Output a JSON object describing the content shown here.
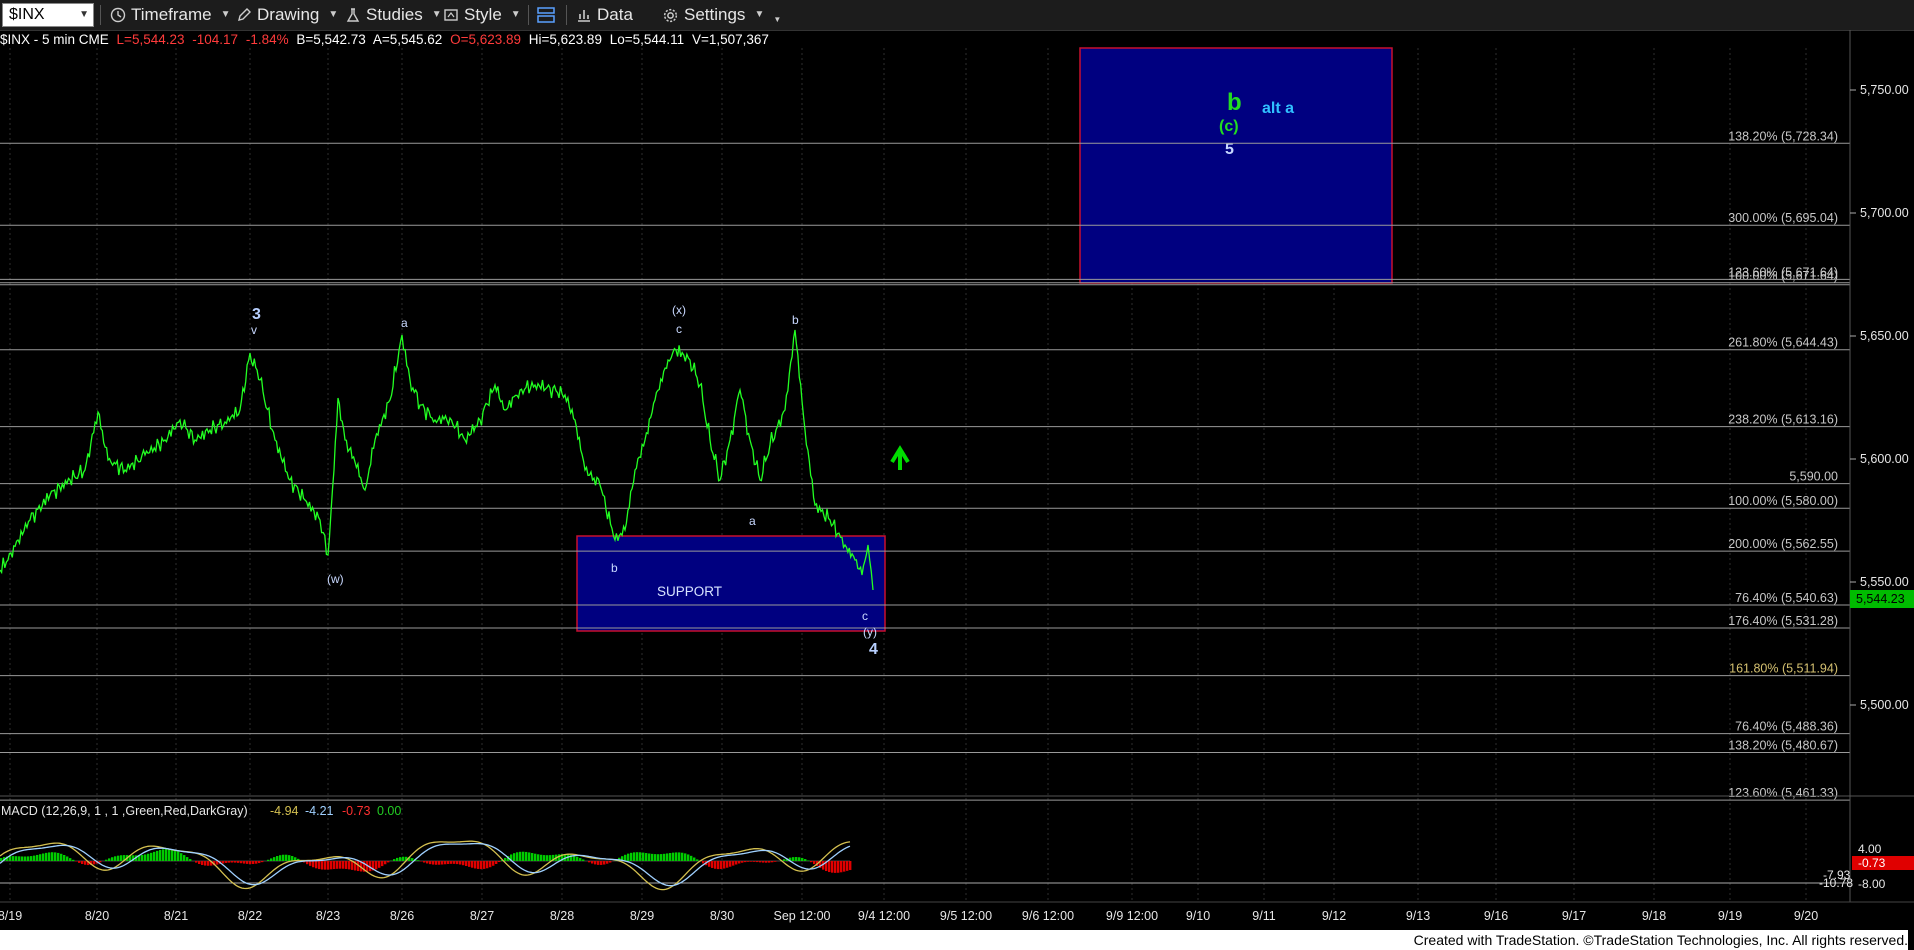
{
  "toolbar": {
    "symbol": "$INX",
    "timeframe": "Timeframe",
    "drawing": "Drawing",
    "studies": "Studies",
    "style": "Style",
    "data": "Data",
    "settings": "Settings"
  },
  "info": {
    "name": "$INX - 5 min  CME",
    "last": "L=5,544.23",
    "change": "-104.17",
    "pct": "-1.84%",
    "bid": "B=5,542.73",
    "ask": "A=5,545.62",
    "open": "O=5,623.89",
    "high": "Hi=5,623.89",
    "low": "Lo=5,544.11",
    "volume": "V=1,507,367"
  },
  "macd": {
    "label": "MACD (12,26,9, 1 , 1 ,Green,Red,DarkGray)",
    "v1": "-4.94",
    "v2": "-4.21",
    "v3": "-0.73",
    "v4": "0.00",
    "axis_top": "4.00",
    "axis_bottom": "-8.00",
    "tag_red": "-0.73",
    "tag1": "-7.93",
    "tag2": "-10.78"
  },
  "colors": {
    "price": "#22ff22",
    "box_fill": "#000080",
    "box_border": "#c8102e",
    "gridline": "#c8c8c8",
    "fib_text": "#c8c8c8",
    "up": "#00ff00",
    "down": "#e00000",
    "label": "#a8d0ff"
  },
  "axis": {
    "price_ticks": [
      "5,750.00",
      "5,700.00",
      "5,650.00",
      "5,600.00",
      "5,550.00",
      "5,500.00"
    ],
    "last_tag": "5,544.23",
    "dates": [
      "8/19",
      "8/20",
      "8/21",
      "8/22",
      "8/23",
      "8/26",
      "8/27",
      "8/28",
      "8/29",
      "8/30",
      "Sep 12:00",
      "9/4 12:00",
      "9/5 12:00",
      "9/6 12:00",
      "9/9 12:00",
      "9/10",
      "9/11",
      "9/12",
      "9/13",
      "9/16",
      "9/17",
      "9/18",
      "9/19",
      "9/20"
    ]
  },
  "fib_labels": [
    {
      "text": "138.20% (5,728.34)",
      "price": 5728.34,
      "color": "#c8c8c8"
    },
    {
      "text": "300.00% (5,695.04)",
      "price": 5695.04,
      "color": "#c8c8c8"
    },
    {
      "text": "100.00% (5,671.64)",
      "price": 5671.64,
      "color": "#c8c8c8"
    },
    {
      "text": "123.60% (5,671.64)",
      "price": 5673.0,
      "color": "#c8c8c8"
    },
    {
      "text": "261.80% (5,644.43)",
      "price": 5644.43,
      "color": "#c8c8c8"
    },
    {
      "text": "238.20% (5,613.16)",
      "price": 5613.16,
      "color": "#c8c8c8"
    },
    {
      "text": "5,590.00",
      "price": 5590.0,
      "color": "#c8c8c8"
    },
    {
      "text": "100.00% (5,580.00)",
      "price": 5580.0,
      "color": "#c8c8c8"
    },
    {
      "text": "200.00% (5,562.55)",
      "price": 5562.55,
      "color": "#c8c8c8"
    },
    {
      "text": "76.40% (5,540.63)",
      "price": 5540.63,
      "color": "#c8c8c8"
    },
    {
      "text": "176.40% (5,531.28)",
      "price": 5531.28,
      "color": "#c8c8c8"
    },
    {
      "text": "161.80% (5,511.94)",
      "price": 5511.94,
      "color": "#d4c070"
    },
    {
      "text": "76.40% (5,488.36)",
      "price": 5488.36,
      "color": "#c8c8c8"
    },
    {
      "text": "138.20% (5,480.67)",
      "price": 5480.67,
      "color": "#c8c8c8"
    },
    {
      "text": "123.60% (5,461.33)",
      "price": 5461.33,
      "color": "#c8c8c8"
    }
  ],
  "boxes": {
    "target_labels": {
      "b": "b",
      "c": "(c)",
      "five": "5",
      "alt": "alt a"
    },
    "support": "SUPPORT"
  },
  "wave_labels": [
    {
      "text": "3",
      "bold": true
    },
    {
      "text": "v"
    },
    {
      "text": "(w)"
    },
    {
      "text": "a"
    },
    {
      "text": "(x)"
    },
    {
      "text": "c"
    },
    {
      "text": "b"
    },
    {
      "text": "b"
    },
    {
      "text": "a"
    },
    {
      "text": "c"
    },
    {
      "text": "(y)"
    },
    {
      "text": "4",
      "bold": true
    }
  ],
  "footer": "Created with TradeStation. ©TradeStation Technologies, Inc. All rights reserved."
}
